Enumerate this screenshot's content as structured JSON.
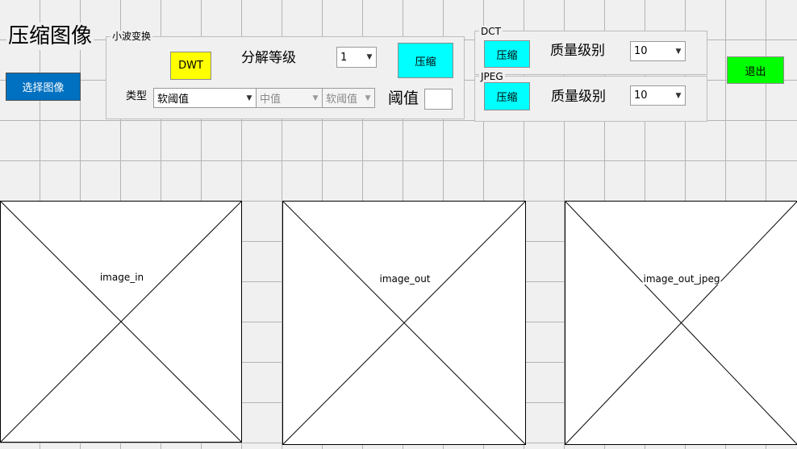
{
  "app": {
    "title": "压缩图像"
  },
  "select_image_button": {
    "label": "选择图像",
    "color": "#0070c0"
  },
  "wavelet_panel": {
    "legend": "小波变换",
    "dwt_button": {
      "label": "DWT",
      "color": "#ffff00"
    },
    "level_label": "分解等级",
    "level_select": {
      "value": "1"
    },
    "compress_button": {
      "label": "压缩",
      "color": "#00ffff"
    },
    "type_label": "类型",
    "type_select": {
      "value": "软阈值"
    },
    "filter_select": {
      "value": "中值"
    },
    "threshold_mode_select": {
      "value": "软阈值"
    },
    "threshold_label": "阈值",
    "threshold_input": {
      "value": ""
    }
  },
  "dct_panel": {
    "legend": "DCT",
    "compress_button": {
      "label": "压缩",
      "color": "#00ffff"
    },
    "quality_label": "质量级别",
    "quality_select": {
      "value": "10"
    }
  },
  "jpeg_panel": {
    "legend": "JPEG",
    "compress_button": {
      "label": "压缩",
      "color": "#00ffff"
    },
    "quality_label": "质量级别",
    "quality_select": {
      "value": "10"
    }
  },
  "exit_button": {
    "label": "退出",
    "color": "#00ff00"
  },
  "axes": {
    "image_in": "image_in",
    "image_out": "image_out",
    "image_out_jpeg": "image_out_jpeg"
  },
  "icons": {
    "dropdown": "chevron-down-icon"
  }
}
